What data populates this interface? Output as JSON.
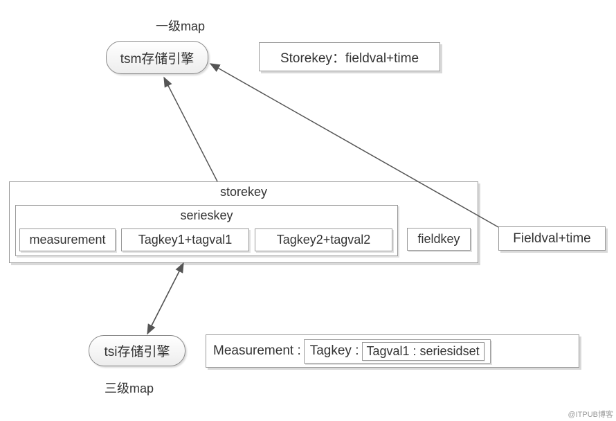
{
  "labels": {
    "top_map": "一级map",
    "bottom_map": "三级map"
  },
  "nodes": {
    "tsm_engine": "tsm存储引擎",
    "tsi_engine": "tsi存储引擎"
  },
  "boxes": {
    "storekey_detail": "Storekey：fieldval+time",
    "fieldval_time": "Fieldval+time"
  },
  "storekey_container": {
    "title": "storekey",
    "serieskey": {
      "title": "serieskey",
      "items": {
        "measurement": "measurement",
        "tag1": "Tagkey1+tagval1",
        "tag2": "Tagkey2+tagval2"
      }
    },
    "fieldkey": "fieldkey"
  },
  "tsi_detail": {
    "measurement": "Measurement :",
    "tagkey": "Tagkey :",
    "tagval": "Tagval1 : seriesidset"
  },
  "watermark": "@ITPUB博客"
}
